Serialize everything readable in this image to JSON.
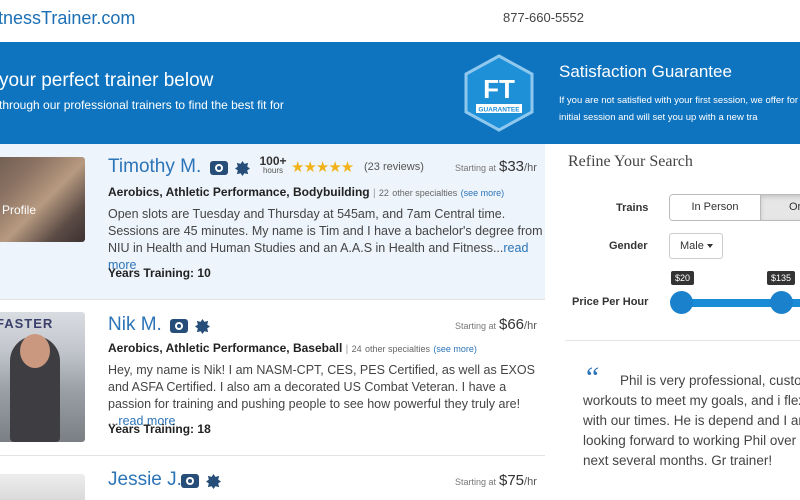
{
  "header": {
    "logo": "tnessTrainer.com",
    "phone": "877-660-5552"
  },
  "banner": {
    "title": "your perfect trainer below",
    "subtitle": "through our professional trainers to find the best fit for",
    "badge_letters": "FT",
    "badge_word": "GUARANTEE",
    "guarantee_title": "Satisfaction Guarantee",
    "guarantee_text": "If you are not satisfied with your first session, we offer for that initial session and will set you up with a new tra"
  },
  "trainers": [
    {
      "name": "Timothy M.",
      "photo_label": "Profile",
      "hours_count": "100+",
      "hours_unit": "hours",
      "rating": 5,
      "stars": "★★★★★",
      "reviews": "(23 reviews)",
      "price_label": "Starting at",
      "price": "$33",
      "price_unit": "/hr",
      "specialties": "Aerobics, Athletic Performance, Bodybuilding",
      "other_count": "22",
      "other_text": "other specialties",
      "see_more": "(see more)",
      "bio": "Open slots are Tuesday and Thursday at 545am, and 7am Central time. Sessions are 45 minutes. My name is Tim and I have a bachelor's degree from NIU in Health and Human Studies and an A.A.S in Health and Fitness...",
      "read_more": "read more",
      "years_label": "Years Training:",
      "years": "10"
    },
    {
      "name": "Nik M.",
      "photo_banner": "FASTER",
      "price_label": "Starting at",
      "price": "$66",
      "price_unit": "/hr",
      "specialties": "Aerobics, Athletic Performance, Baseball",
      "other_count": "24",
      "other_text": "other specialties",
      "see_more": "(see more)",
      "bio": "Hey, my name is Nik! I am NASM-CPT, CES, PES Certified, as well as EXOS and ASFA Certified. I also am a decorated US Combat Veteran. I have a passion for training and pushing people to see how powerful they truly are! ...",
      "read_more": "read more",
      "years_label": "Years Training:",
      "years": "18"
    },
    {
      "name": "Jessie J.",
      "price_label": "Starting at",
      "price": "$75",
      "price_unit": "/hr"
    }
  ],
  "refine": {
    "title": "Refine Your Search",
    "trains_label": "Trains",
    "trains_options": [
      "In Person",
      "Or"
    ],
    "gender_label": "Gender",
    "gender_value": "Male",
    "price_label": "Price Per Hour",
    "price_min": "$20",
    "price_max": "$135"
  },
  "testimonial": {
    "quote_mark": "“",
    "text": "Phil is very professional, custo the workouts to meet my goals, and i flexible with our times. He is depend and I am looking forward to working Phil over the next several months. Gr trainer!"
  },
  "colors": {
    "brand_blue": "#0f74bf",
    "link_blue": "#2c74b8",
    "star_gold": "#f2b21a",
    "slider_blue": "#1a8bd6"
  }
}
